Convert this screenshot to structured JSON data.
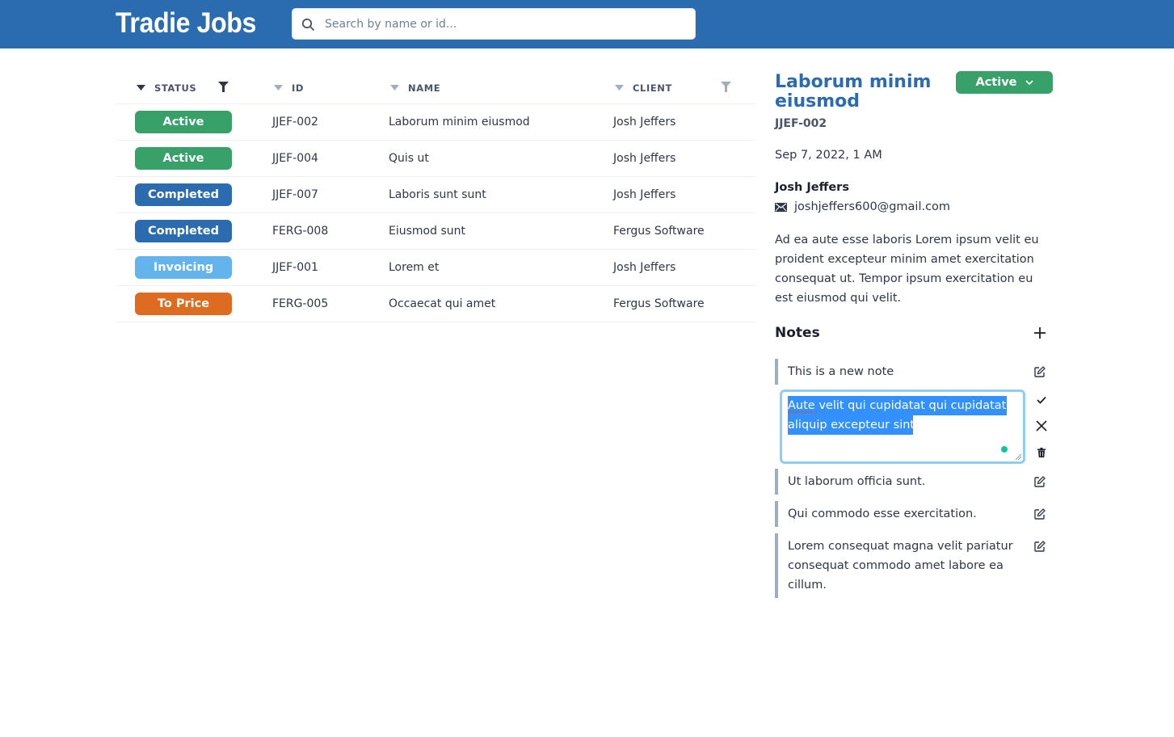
{
  "header": {
    "app_title": "Tradie Jobs",
    "search": {
      "placeholder": "Search by name or id...",
      "value": ""
    }
  },
  "table": {
    "columns": [
      {
        "key": "status",
        "label": "STATUS",
        "sort_icon": "sort-caret-down-icon",
        "sort_active": true,
        "filterable": true,
        "filter_active": true
      },
      {
        "key": "id",
        "label": "ID",
        "sort_icon": "sort-caret-down-icon",
        "sort_active": false,
        "filterable": false
      },
      {
        "key": "name",
        "label": "NAME",
        "sort_icon": "sort-caret-down-icon",
        "sort_active": false,
        "filterable": false
      },
      {
        "key": "client",
        "label": "CLIENT",
        "sort_icon": "sort-caret-down-icon",
        "sort_active": false,
        "filterable": true,
        "filter_active": false
      }
    ],
    "rows": [
      {
        "status": "Active",
        "id": "JJEF-002",
        "name": "Laborum minim eiusmod",
        "client": "Josh Jeffers"
      },
      {
        "status": "Active",
        "id": "JJEF-004",
        "name": "Quis ut",
        "client": "Josh Jeffers"
      },
      {
        "status": "Completed",
        "id": "JJEF-007",
        "name": "Laboris sunt sunt",
        "client": "Josh Jeffers"
      },
      {
        "status": "Completed",
        "id": "FERG-008",
        "name": "Eiusmod sunt",
        "client": "Fergus Software"
      },
      {
        "status": "Invoicing",
        "id": "JJEF-001",
        "name": "Lorem et",
        "client": "Josh Jeffers"
      },
      {
        "status": "To Price",
        "id": "FERG-005",
        "name": "Occaecat qui amet",
        "client": "Fergus Software"
      }
    ]
  },
  "status_colors": {
    "Active": "#38a169",
    "Completed": "#2b6cb0",
    "Invoicing": "#63b3ed",
    "To Price": "#dd6b20"
  },
  "colors": {
    "header_bg": "#2b6cb0",
    "title_accent": "#2b6cb0",
    "editor_focus": "#90cdf4",
    "selection": "#3390ff"
  },
  "detail": {
    "title": "Laborum minim eiusmod",
    "status": "Active",
    "id": "JJEF-002",
    "date": "Sep 7, 2022, 1 AM",
    "client_name": "Josh Jeffers",
    "client_email": "joshjeffers600@gmail.com",
    "description": "Ad ea aute esse laboris Lorem ipsum velit eu proident excepteur minim amet exercitation consequat ut. Tempor ipsum exercitation eu est eiusmod qui velit.",
    "notes_title": "Notes",
    "notes": [
      {
        "text": "This is a new note",
        "editing": false
      },
      {
        "text": "Aute velit qui cupidatat qui cupidatat aliquip excepteur sint.",
        "editing": true,
        "lines": [
          "Aute velit qui cupidatat qui cupidatat",
          "aliquip excepteur sint."
        ]
      },
      {
        "text": "Ut laborum officia sunt.",
        "editing": false
      },
      {
        "text": "Qui commodo esse exercitation.",
        "editing": false
      },
      {
        "text": "Lorem consequat magna velit pariatur consequat commodo amet labore ea cillum.",
        "editing": false
      }
    ]
  }
}
